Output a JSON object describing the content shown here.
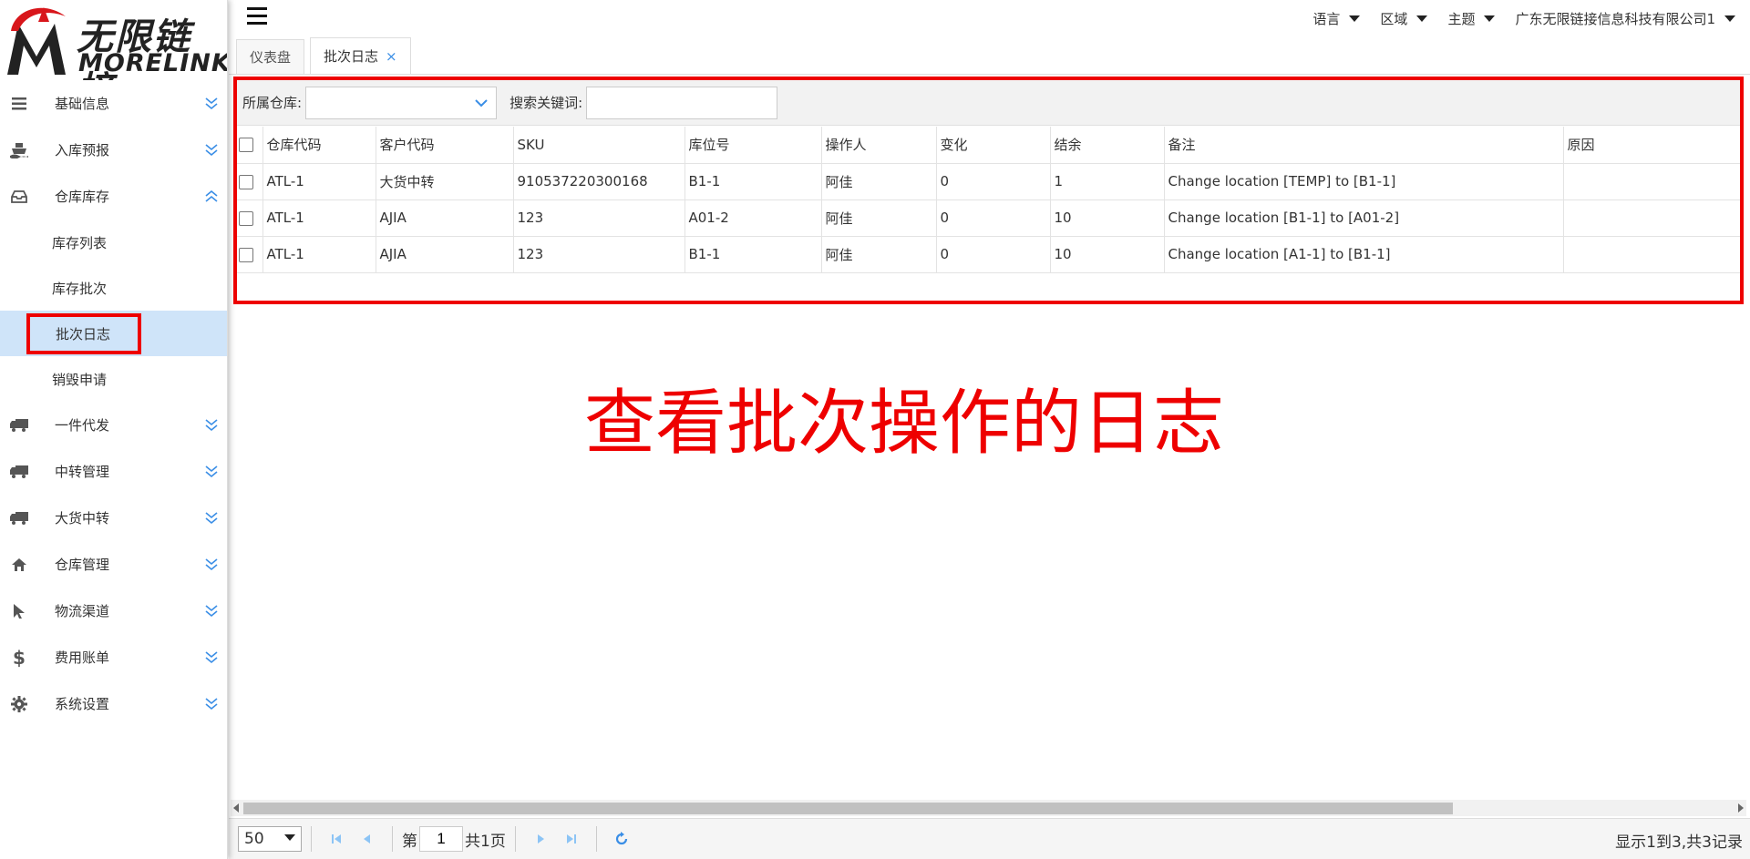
{
  "logo": {
    "cn": "无限链接",
    "en": "MORELINK"
  },
  "sidebar": {
    "items": [
      {
        "label": "基础信息",
        "icon": "bars-icon"
      },
      {
        "label": "入库预报",
        "icon": "ship-icon"
      },
      {
        "label": "仓库库存",
        "icon": "inbox-icon",
        "expanded": true,
        "children": [
          "库存列表",
          "库存批次",
          "批次日志",
          "销毁申请"
        ],
        "active_child": "批次日志"
      },
      {
        "label": "一件代发",
        "icon": "truck-icon"
      },
      {
        "label": "中转管理",
        "icon": "truck-icon"
      },
      {
        "label": "大货中转",
        "icon": "truck-icon"
      },
      {
        "label": "仓库管理",
        "icon": "home-icon"
      },
      {
        "label": "物流渠道",
        "icon": "cursor-icon"
      },
      {
        "label": "费用账单",
        "icon": "dollar-icon"
      },
      {
        "label": "系统设置",
        "icon": "gear-icon"
      }
    ]
  },
  "topbar": {
    "language": "语言",
    "region": "区域",
    "theme": "主题",
    "company": "广东无限链接信息科技有限公司1"
  },
  "tabs": [
    {
      "label": "仪表盘",
      "active": false
    },
    {
      "label": "批次日志",
      "active": true,
      "close": "×"
    }
  ],
  "filters": {
    "warehouse_label": "所属仓库:",
    "warehouse_value": "",
    "keyword_label": "搜索关键词:",
    "keyword_value": ""
  },
  "table": {
    "columns": [
      "仓库代码",
      "客户代码",
      "SKU",
      "库位号",
      "操作人",
      "变化",
      "结余",
      "备注",
      "原因"
    ],
    "rows": [
      [
        "ATL-1",
        "大货中转",
        "910537220300168",
        "B1-1",
        "阿佳",
        "0",
        "1",
        "Change location [TEMP] to [B1-1]",
        ""
      ],
      [
        "ATL-1",
        "AJIA",
        "123",
        "A01-2",
        "阿佳",
        "0",
        "10",
        "Change location [B1-1] to [A01-2]",
        ""
      ],
      [
        "ATL-1",
        "AJIA",
        "123",
        "B1-1",
        "阿佳",
        "0",
        "10",
        "Change location [A1-1] to [B1-1]",
        ""
      ]
    ]
  },
  "annotation": {
    "text": "查看批次操作的日志",
    "color": "#e00000"
  },
  "pager": {
    "page_size": "50",
    "page_prefix": "第",
    "page_value": "1",
    "page_total": "共1页",
    "info": "显示1到3,共3记录"
  },
  "colors": {
    "accent": "#3a8ee6",
    "active_bg": "#cfe4f9",
    "annotation_red": "#e00000"
  }
}
